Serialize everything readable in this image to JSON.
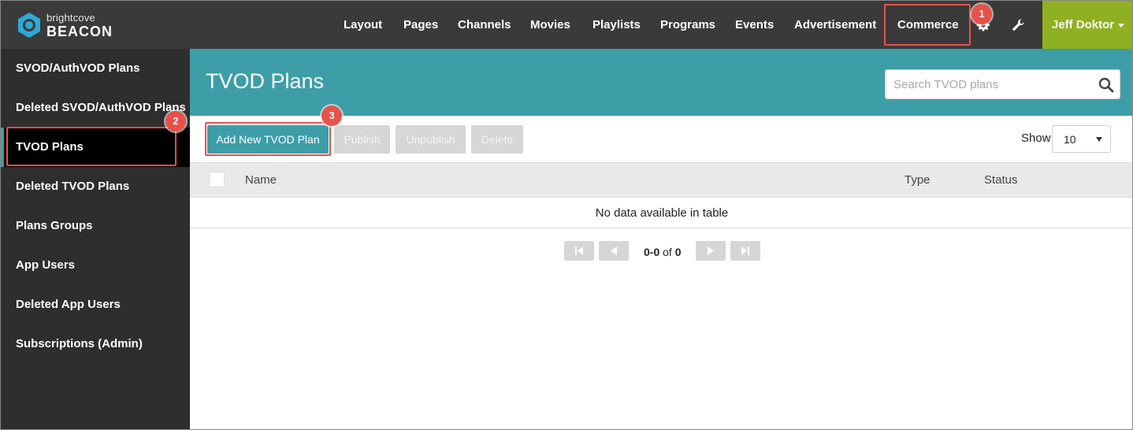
{
  "brand": {
    "small": "brightcove",
    "big": "BEACON"
  },
  "nav": {
    "items": [
      "Layout",
      "Pages",
      "Channels",
      "Movies",
      "Playlists",
      "Programs",
      "Events",
      "Advertisement",
      "Commerce"
    ],
    "user": "Jeff Doktor"
  },
  "sidebar": {
    "items": [
      "SVOD/AuthVOD Plans",
      "Deleted SVOD/AuthVOD Plans",
      "TVOD Plans",
      "Deleted TVOD Plans",
      "Plans Groups",
      "App Users",
      "Deleted App Users",
      "Subscriptions (Admin)"
    ],
    "active_index": 2
  },
  "main": {
    "title": "TVOD Plans",
    "search_placeholder": "Search TVOD plans",
    "buttons": {
      "add": "Add New TVOD Plan",
      "publish": "Publish",
      "unpublish": "Unpublish",
      "delete": "Delete"
    },
    "show_label": "Show",
    "show_value": "10",
    "columns": {
      "name": "Name",
      "type": "Type",
      "status": "Status"
    },
    "empty_message": "No data available in table",
    "pager": {
      "range": "0-0",
      "of": "of",
      "total": "0"
    }
  },
  "annotations": {
    "badge1": "1",
    "badge2": "2",
    "badge3": "3"
  },
  "colors": {
    "topbar": "#3a3a3a",
    "sidebar": "#2e2e2e",
    "accent": "#3d9ea8",
    "user": "#8fb021",
    "highlight": "#e8514a"
  },
  "icons": [
    "brightcove-logo-icon",
    "gear-icon",
    "wrench-icon",
    "search-icon",
    "first-page-icon",
    "prev-page-icon",
    "next-page-icon",
    "last-page-icon"
  ]
}
